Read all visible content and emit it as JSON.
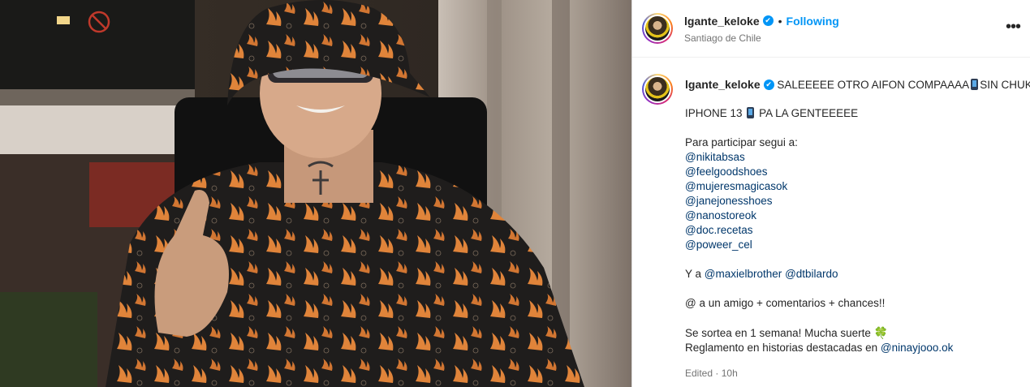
{
  "post": {
    "author": "lgante_keloke",
    "verified_mark": "✔",
    "separator": "•",
    "follow_status": "Following",
    "location": "Santiago de Chile",
    "more_icon": "•••"
  },
  "caption": {
    "author": "lgante_keloke",
    "line1_a": "SALEEEEE OTRO AIFON COMPAAAA",
    "line1_b": "SIN CHUKU",
    "line2_a": "IPHONE 13",
    "line2_b": "PA LA GENTEEEEE",
    "follow_intro": "Para participar segui a:",
    "mentions": [
      "@nikitabsas",
      "@feelgoodshoes",
      "@mujeresmagicasok",
      "@janejonesshoes",
      "@nanostoreok",
      "@doc.recetas",
      "@poweer_cel"
    ],
    "also_prefix": "Y a",
    "also_mention_1": "@maxielbrother",
    "also_mention_2": "@dtbilardo",
    "tag_line": "@ a un amigo + comentarios + chances!!",
    "raffle_line": "Se sortea en 1 semana! Mucha suerte",
    "clover": "🍀",
    "rules_prefix": "Reglamento en historias destacadas en",
    "rules_mention": "@ninayjooo.ok"
  },
  "meta": {
    "edited": "Edited",
    "dot": "·",
    "age": "10h"
  },
  "icons": {
    "verified": "verified-badge-icon",
    "more": "more-options-icon",
    "phone": "mobile-phone-emoji",
    "clover": "four-leaf-clover-emoji"
  },
  "colors": {
    "link": "#0095f6",
    "mention": "#00376b",
    "text": "#262626",
    "muted": "#737373"
  }
}
